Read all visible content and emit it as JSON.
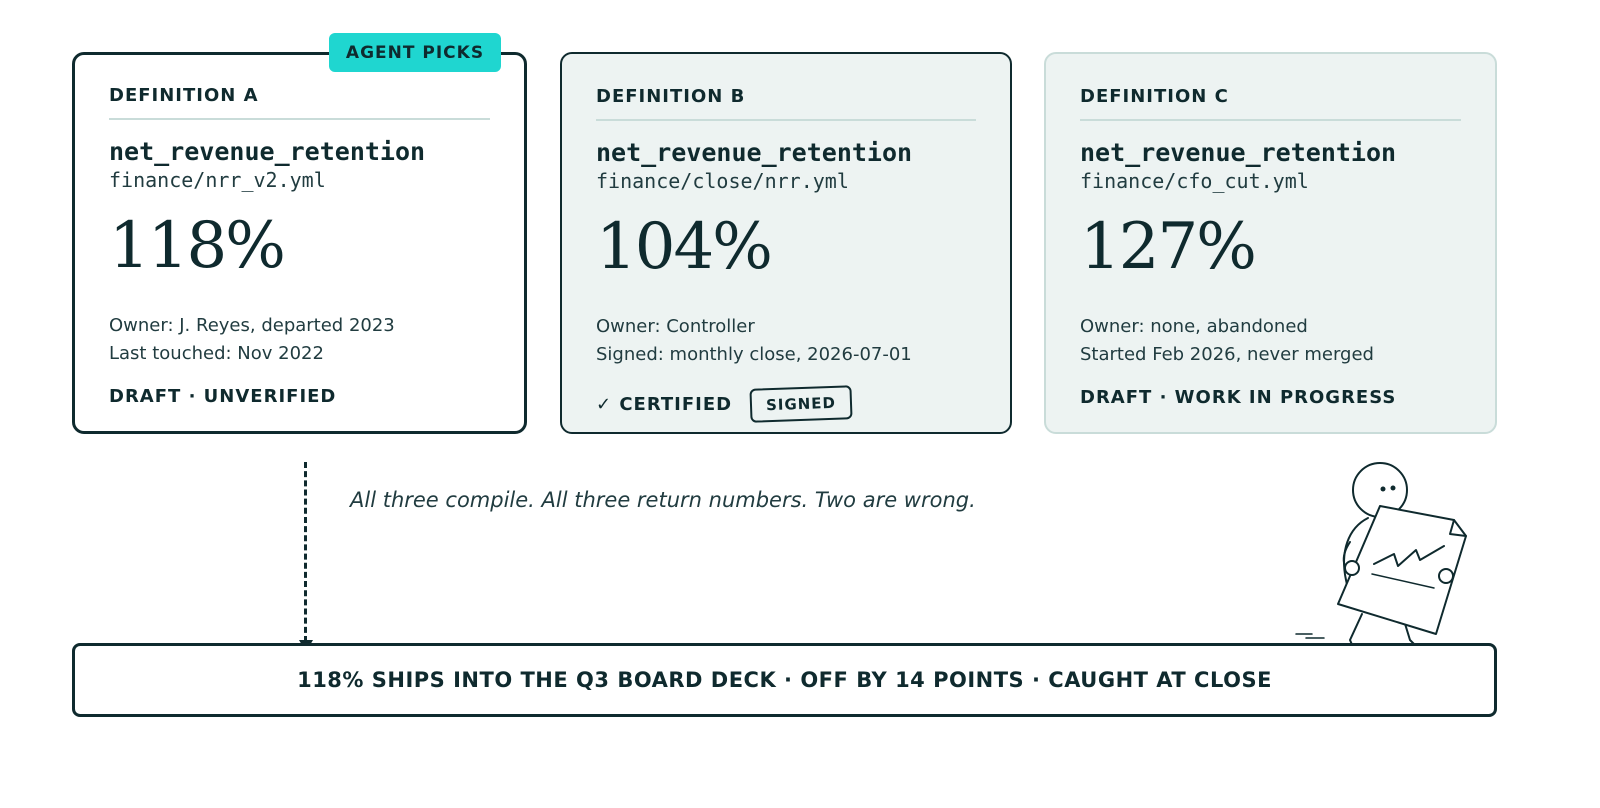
{
  "badge": {
    "label": "AGENT PICKS"
  },
  "cards": [
    {
      "label": "DEFINITION A",
      "metric": "net_revenue_retention",
      "file": "finance/nrr_v2.yml",
      "value": "118%",
      "meta_1": "Owner: J. Reyes, departed 2023",
      "meta_2": "Last touched: Nov 2022",
      "status": "DRAFT · UNVERIFIED"
    },
    {
      "label": "DEFINITION B",
      "metric": "net_revenue_retention",
      "file": "finance/close/nrr.yml",
      "value": "104%",
      "meta_1": "Owner: Controller",
      "meta_2": "Signed: monthly close, 2026-07-01",
      "status": "✓ CERTIFIED",
      "stamp": "SIGNED"
    },
    {
      "label": "DEFINITION C",
      "metric": "net_revenue_retention",
      "file": "finance/cfo_cut.yml",
      "value": "127%",
      "meta_1": "Owner: none, abandoned",
      "meta_2": "Started Feb 2026, never merged",
      "status": "DRAFT · WORK IN PROGRESS"
    }
  ],
  "caption": "All three compile. All three return numbers. Two are wrong.",
  "result": "118% SHIPS INTO THE Q3 BOARD DECK · OFF BY 14 POINTS · CAUGHT AT CLOSE",
  "colors": {
    "ink": "#0f2a2e",
    "accent": "#1fd6d0",
    "panel": "#edf3f2",
    "rule": "#c9dcd9"
  }
}
